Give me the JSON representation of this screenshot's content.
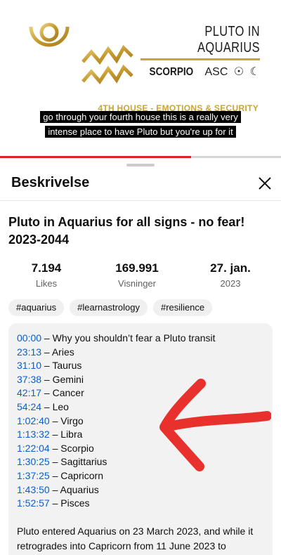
{
  "video": {
    "title": "PLUTO IN AQUARIUS",
    "asc_sign": "SCORPIO",
    "asc_label": "ASC",
    "sun_glyph": "☉",
    "moon_glyph": "☾",
    "house_label": "4TH HOUSE - EMOTIONS & SECURITY",
    "caption": "go through your fourth house this is a really very intense place to have Pluto but you're up for it",
    "progress_fraction": 0.68,
    "accent_color": "#c9a43a"
  },
  "sheet": {
    "title": "Beskrivelse",
    "close_icon": "close-icon"
  },
  "description": {
    "title": "Pluto in Aquarius for all signs - no fear! 2023-2044",
    "stats": [
      {
        "value": "7.194",
        "label": "Likes"
      },
      {
        "value": "169.991",
        "label": "Visninger"
      },
      {
        "value": "27. jan.",
        "label": "2023"
      }
    ],
    "tags": [
      "#aquarius",
      "#learnastrology",
      "#resilience"
    ],
    "chapters": [
      {
        "time": "00:00",
        "text": " – Why you shouldn’t fear a Pluto transit"
      },
      {
        "time": "23:13",
        "text": " – Aries"
      },
      {
        "time": "31:10",
        "text": " – Taurus"
      },
      {
        "time": "37:38",
        "text": " – Gemini"
      },
      {
        "time": "42:17",
        "text": " – Cancer"
      },
      {
        "time": "54:24",
        "text": " – Leo"
      },
      {
        "time": "1:02:40",
        "text": " – Virgo"
      },
      {
        "time": "1:13:32",
        "text": " – Libra"
      },
      {
        "time": "1:22:04",
        "text": " – Scorpio"
      },
      {
        "time": "1:30:25",
        "text": " – Sagittarius"
      },
      {
        "time": "1:37:25",
        "text": " – Capricorn"
      },
      {
        "time": "1:43:50",
        "text": " – Aquarius"
      },
      {
        "time": "1:52:57",
        "text": " – Pisces"
      }
    ],
    "body": "Pluto entered Aquarius on 23 March 2023, and while it retrogrades into Capricorn from 11 June 2023 to",
    "link_color": "#065fd4",
    "annotation_color": "#e8302c"
  }
}
